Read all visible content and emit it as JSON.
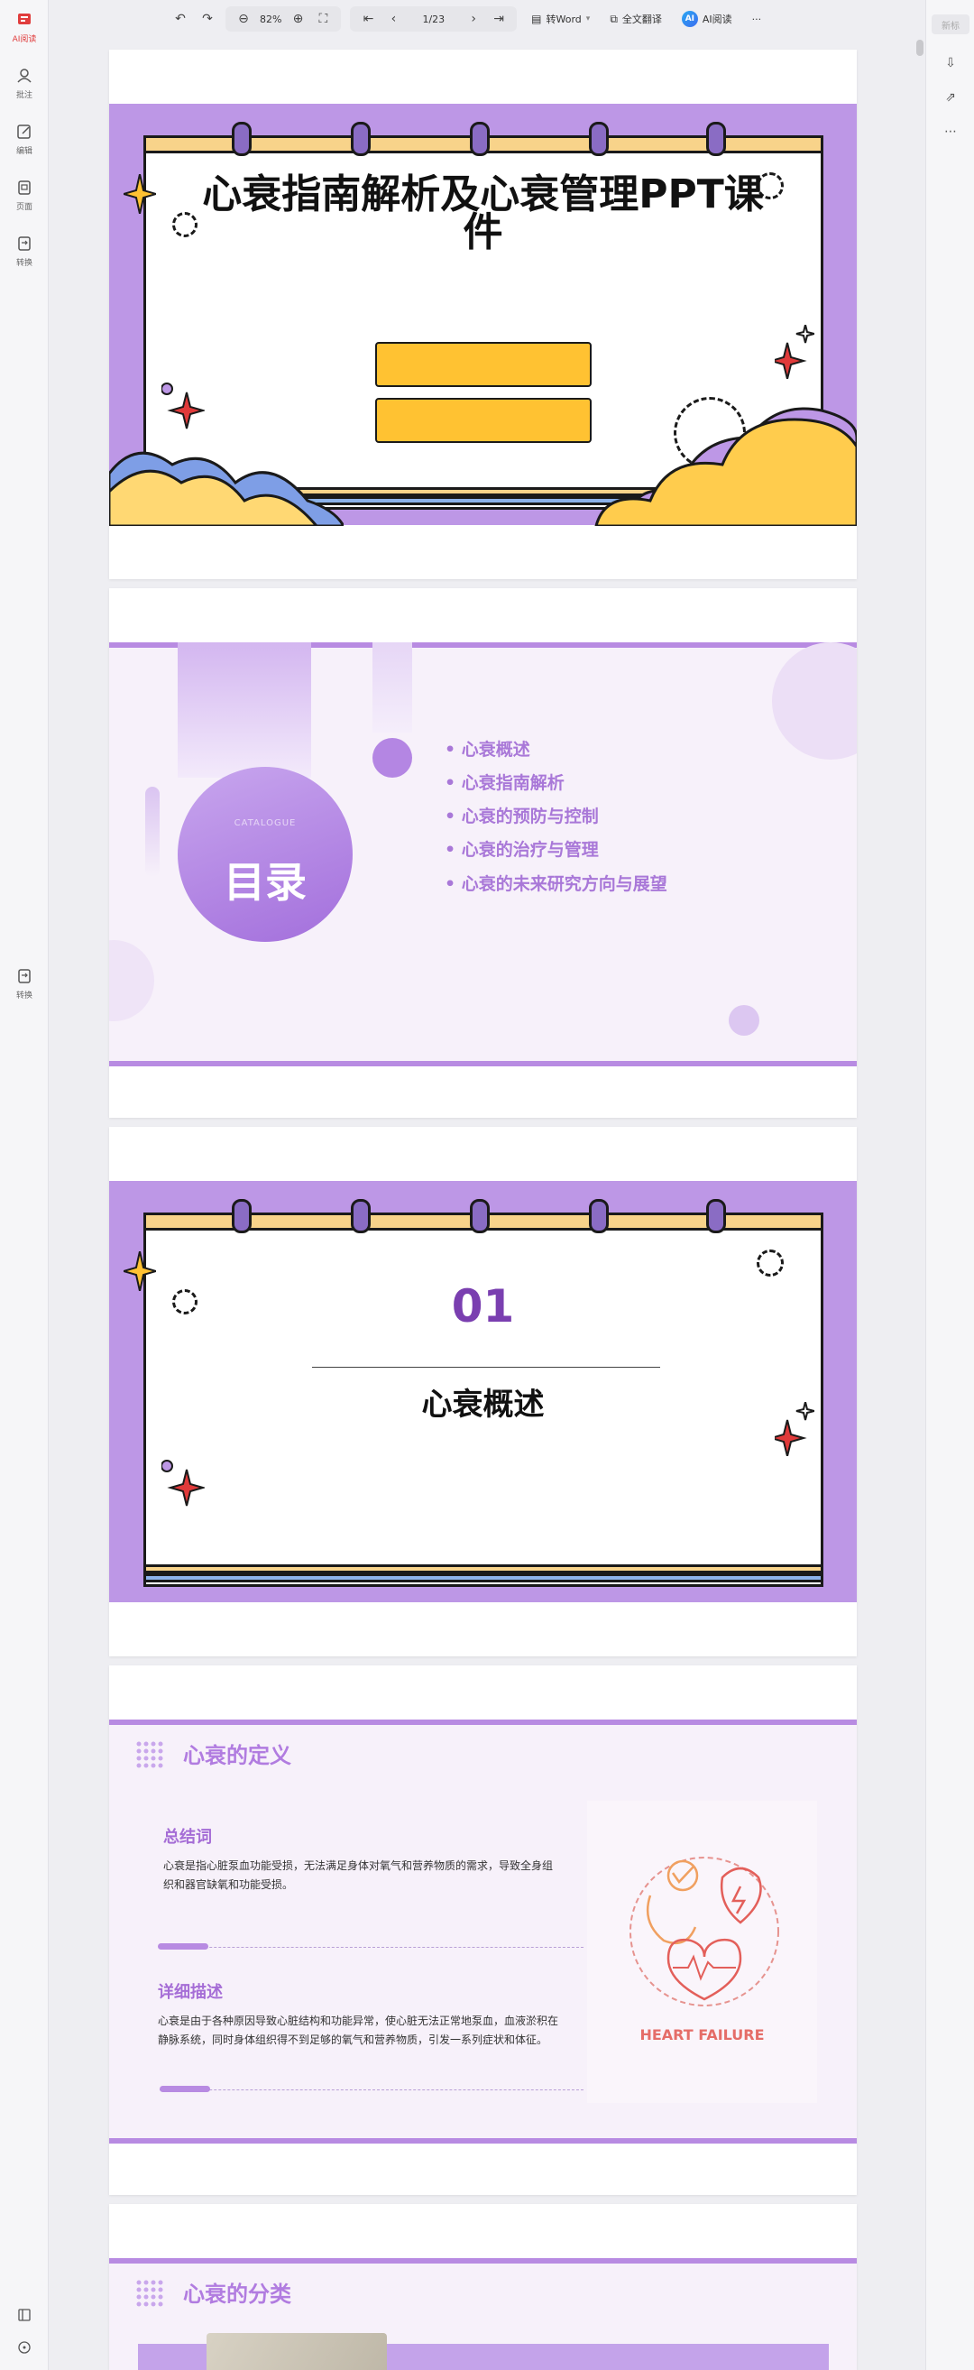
{
  "left_sidebar": {
    "items": [
      {
        "label": "AI阅读"
      },
      {
        "label": "批注"
      },
      {
        "label": "编辑"
      },
      {
        "label": "页面"
      },
      {
        "label": "转换"
      },
      {
        "label": "转换"
      }
    ]
  },
  "right_sidebar": {
    "top_button": "新标"
  },
  "toolbar": {
    "zoom": "82%",
    "page_indicator": "1/23",
    "to_word": "转Word",
    "translate": "全文翻译",
    "ai_read": "AI阅读",
    "more": "···"
  },
  "slide1": {
    "title": "心衰指南解析及心衰管理PPT课件"
  },
  "slide2": {
    "catalogue_en": "CATALOGUE",
    "catalogue_cn": "目录",
    "items": [
      "心衰概述",
      "心衰指南解析",
      "心衰的预防与控制",
      "心衰的治疗与管理",
      "心衰的未来研究方向与展望"
    ]
  },
  "slide3": {
    "number": "01",
    "title": "心衰概述"
  },
  "slide4": {
    "title": "心衰的定义",
    "summary_head": "总结词",
    "summary_text": "心衰是指心脏泵血功能受损，无法满足身体对氧气和营养物质的需求，导致全身组织和器官缺氧和功能受损。",
    "detail_head": "详细描述",
    "detail_text": "心衰是由于各种原因导致心脏结构和功能异常，使心脏无法正常地泵血，血液淤积在静脉系统，同时身体组织得不到足够的氧气和营养物质，引发一系列症状和体征。",
    "image_label": "HEART FAILURE"
  },
  "slide5": {
    "title": "心衰的分类"
  }
}
